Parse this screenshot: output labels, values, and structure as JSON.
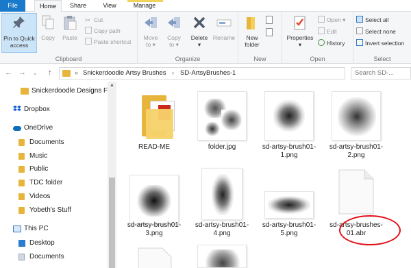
{
  "tabs": {
    "file": "File",
    "home": "Home",
    "share": "Share",
    "view": "View",
    "manage": "Manage"
  },
  "ribbon": {
    "clipboard": {
      "pin_label_1": "Pin to Quick",
      "pin_label_2": "access",
      "copy": "Copy",
      "paste": "Paste",
      "cut": "Cut",
      "copy_path": "Copy path",
      "paste_shortcut": "Paste shortcut",
      "group": "Clipboard"
    },
    "organize": {
      "move_to_1": "Move",
      "move_to_2": "to",
      "copy_to_1": "Copy",
      "copy_to_2": "to",
      "delete": "Delete",
      "rename": "Rename",
      "group": "Organize"
    },
    "new": {
      "new_folder_1": "New",
      "new_folder_2": "folder",
      "group": "New"
    },
    "open": {
      "properties": "Properties",
      "open": "Open",
      "edit": "Edit",
      "history": "History",
      "group": "Open"
    },
    "select": {
      "select_all": "Select all",
      "select_none": "Select none",
      "invert": "Invert selection",
      "group": "Select"
    }
  },
  "address": {
    "crumbs": [
      "Snickerdoodle Artsy Brushes",
      "SD-ArtsyBrushes-1"
    ],
    "search_placeholder": "Search SD-..."
  },
  "nav": {
    "items": [
      {
        "label": "Snickerdoodle Designs Fo",
        "icon": "folder-icon"
      },
      {
        "label": "Dropbox",
        "icon": "dropbox-icon"
      },
      {
        "label": "OneDrive",
        "icon": "onedrive-icon"
      },
      {
        "label": "Documents",
        "icon": "folder-icon"
      },
      {
        "label": "Music",
        "icon": "folder-icon"
      },
      {
        "label": "Public",
        "icon": "folder-icon"
      },
      {
        "label": "TDC folder",
        "icon": "folder-icon"
      },
      {
        "label": "Videos",
        "icon": "folder-icon"
      },
      {
        "label": "Yobeth's Stuff",
        "icon": "folder-icon"
      },
      {
        "label": "This PC",
        "icon": "pc-icon"
      },
      {
        "label": "Desktop",
        "icon": "desktop-icon"
      },
      {
        "label": "Documents",
        "icon": "folder-icon"
      }
    ]
  },
  "files": [
    {
      "name_1": "READ-ME",
      "name_2": "",
      "kind": "folder"
    },
    {
      "name_1": "folder.jpg",
      "name_2": "",
      "kind": "image"
    },
    {
      "name_1": "sd-artsy-brush01-",
      "name_2": "1.png",
      "kind": "image"
    },
    {
      "name_1": "sd-artsy-brush01-",
      "name_2": "2.png",
      "kind": "image"
    },
    {
      "name_1": "sd-artsy-brush01-",
      "name_2": "3.png",
      "kind": "image"
    },
    {
      "name_1": "sd-artsy-brush01-",
      "name_2": "4.png",
      "kind": "image"
    },
    {
      "name_1": "sd-artsy-brush01-",
      "name_2": "5.png",
      "kind": "image"
    },
    {
      "name_1": "sd-artsy-brushes-",
      "name_2": "01.abr",
      "kind": "file"
    }
  ],
  "colors": {
    "accent": "#1979ca",
    "folder": "#e8b53c",
    "highlight": "#e3101a"
  }
}
